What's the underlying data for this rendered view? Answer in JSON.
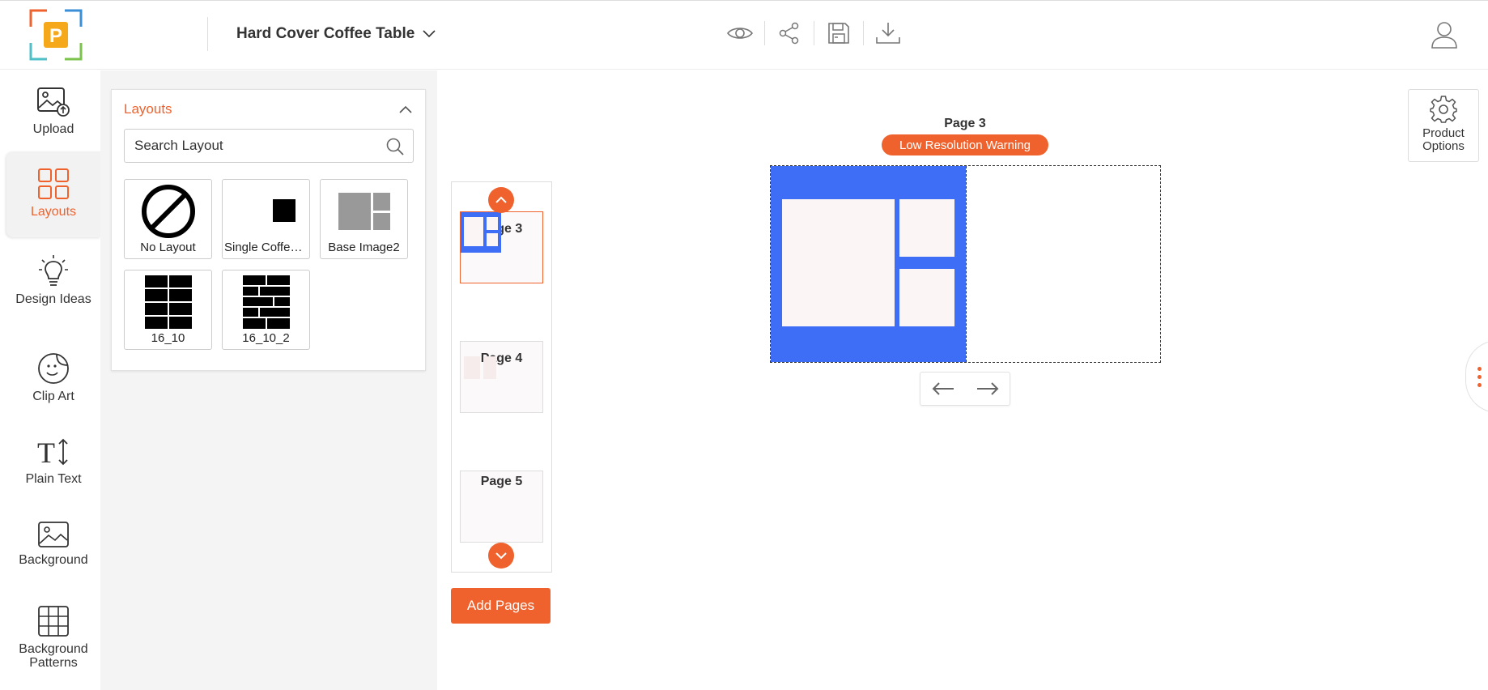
{
  "header": {
    "product_title": "Hard Cover Coffee Table",
    "icons": [
      "eye-icon",
      "share-icon",
      "save-icon",
      "download-icon",
      "user-icon"
    ]
  },
  "rail": {
    "items": [
      {
        "label": "Upload",
        "icon": "upload-image-icon"
      },
      {
        "label": "Layouts",
        "icon": "layouts-grid-icon",
        "active": true
      },
      {
        "label": "Design Ideas",
        "icon": "lightbulb-icon"
      },
      {
        "label": "Clip Art",
        "icon": "sticker-icon"
      },
      {
        "label": "Plain Text",
        "icon": "text-icon"
      },
      {
        "label": "Background",
        "icon": "image-icon"
      },
      {
        "label": "Background Patterns",
        "icon": "grid-pattern-icon"
      }
    ]
  },
  "layouts_panel": {
    "title": "Layouts",
    "search_placeholder": "Search Layout",
    "tiles": [
      {
        "label": "No Layout"
      },
      {
        "label": "Single Coffee Table"
      },
      {
        "label": "Base Image2"
      },
      {
        "label": "16_10"
      },
      {
        "label": "16_10_2"
      }
    ]
  },
  "page_strip": {
    "pages": [
      {
        "label": "Page 3",
        "active": true
      },
      {
        "label": "Page 4"
      },
      {
        "label": "Page 5"
      }
    ],
    "add_pages_label": "Add Pages"
  },
  "canvas": {
    "page_name": "Page 3",
    "warning": "Low Resolution Warning"
  },
  "product_options_label": "Product Options",
  "colors": {
    "accent": "#f0622d",
    "spread_blue": "#3d6ef5"
  }
}
